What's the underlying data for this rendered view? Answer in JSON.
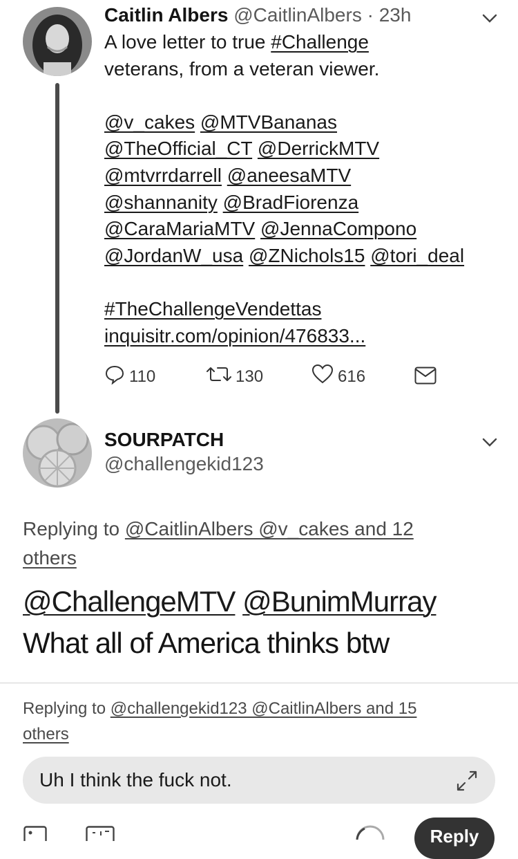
{
  "tweet1": {
    "name": "Caitlin Albers",
    "handle": "@CaitlinAlbers",
    "time": "23h",
    "text_line1_plain": "A love letter to true ",
    "hashtag_challenge": "#Challenge",
    "text_line2": "veterans, from a veteran viewer.",
    "mentions": [
      "@v_cakes",
      "@MTVBananas",
      "@TheOfficial_CT",
      "@DerrickMTV",
      "@mtvrrdarrell",
      "@aneesaMTV",
      "@shannanity",
      "@BradFiorenza",
      "@CaraMariaMTV",
      "@JennaCompono",
      "@JordanW_usa",
      "@ZNichols15",
      "@tori_deal"
    ],
    "hashtag_vendettas": "#TheChallengeVendettas",
    "link": "inquisitr.com/opinion/476833...",
    "replies": "110",
    "retweets": "130",
    "likes": "616"
  },
  "tweet2": {
    "name": "SOURPATCH",
    "handle": "@challengekid123",
    "replying_prefix": "Replying to ",
    "replying_targets_line1": "@CaitlinAlbers @v_cakes and 12",
    "replying_targets_line2": "others",
    "mention1": "@ChallengeMTV",
    "mention2": "@BunimMurray",
    "body": "What all of America thinks btw"
  },
  "composer": {
    "replying_prefix": "Replying to ",
    "replying_targets_line1": "@challengekid123 @CaitlinAlbers and 15",
    "replying_targets_line2": "others",
    "input_value": "Uh I think the fuck not.",
    "reply_button": "Reply"
  }
}
